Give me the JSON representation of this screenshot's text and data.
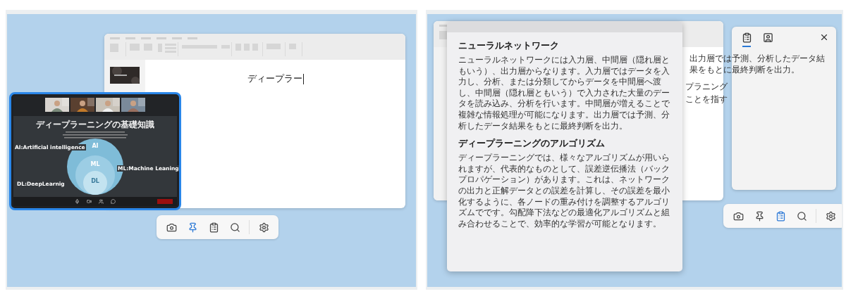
{
  "left_scene": {
    "editor": {
      "text": "ディープラー"
    },
    "meeting": {
      "slide": {
        "title": "ディープラーニングの基礎知識",
        "labels": [
          {
            "kind": "ai",
            "text": "AI:Artificial intelligence"
          },
          {
            "kind": "ml",
            "text": "ML:Machine Leaning"
          },
          {
            "kind": "dl",
            "text": "DL:DeepLearnig"
          }
        ],
        "circles": [
          "AI",
          "ML",
          "DL"
        ]
      }
    },
    "toolbar": [
      {
        "kind": "camera",
        "selected": false
      },
      {
        "kind": "pin",
        "selected": true
      },
      {
        "kind": "clipboard",
        "selected": false
      },
      {
        "kind": "search",
        "selected": false
      },
      {
        "kind": "settings",
        "selected": false
      }
    ]
  },
  "right_scene": {
    "background_texts": [
      "出力層では予測、分析したデータ結果をもとに最終判断を出力。",
      "プラニング",
      "ことを指す"
    ],
    "article": [
      {
        "heading": "ニューラルネットワーク",
        "body": "ニューラルネットワークには入力層、中間層（隠れ層ともいう）、出力層からなります。入力層ではデータを入力し、分析、または分類してからデータを中間層へ渡し、中間層（隠れ層ともいう）で入力された大量のデータを読み込み、分析を行います。中間層が増えることで複雑な情報処理が可能になります。出力層では予測、分析したデータ結果をもとに最終判断を出力。"
      },
      {
        "heading": "ディープラーニングのアルゴリズム",
        "body": "ディープラーニングでは、様々なアルゴリズムが用いられますが、代表的なものとして、誤差逆伝播法（バックプロパゲーション）があります。これは、ネットワークの出力と正解データとの誤差を計算し、その誤差を最小化するように、各ノードの重み付けを調整するアルゴリズムでです。勾配降下法などの最適化アルゴリズムと組み合わせることで、効率的な学習が可能となります。"
      }
    ],
    "side_panel": {
      "tabs": [
        {
          "kind": "clipboard",
          "selected": true
        },
        {
          "kind": "contact",
          "selected": false
        }
      ]
    },
    "toolbar": [
      {
        "kind": "camera",
        "selected": false
      },
      {
        "kind": "pin",
        "selected": false
      },
      {
        "kind": "clipboard",
        "selected": true
      },
      {
        "kind": "search",
        "selected": false
      },
      {
        "kind": "settings",
        "selected": false
      }
    ]
  }
}
